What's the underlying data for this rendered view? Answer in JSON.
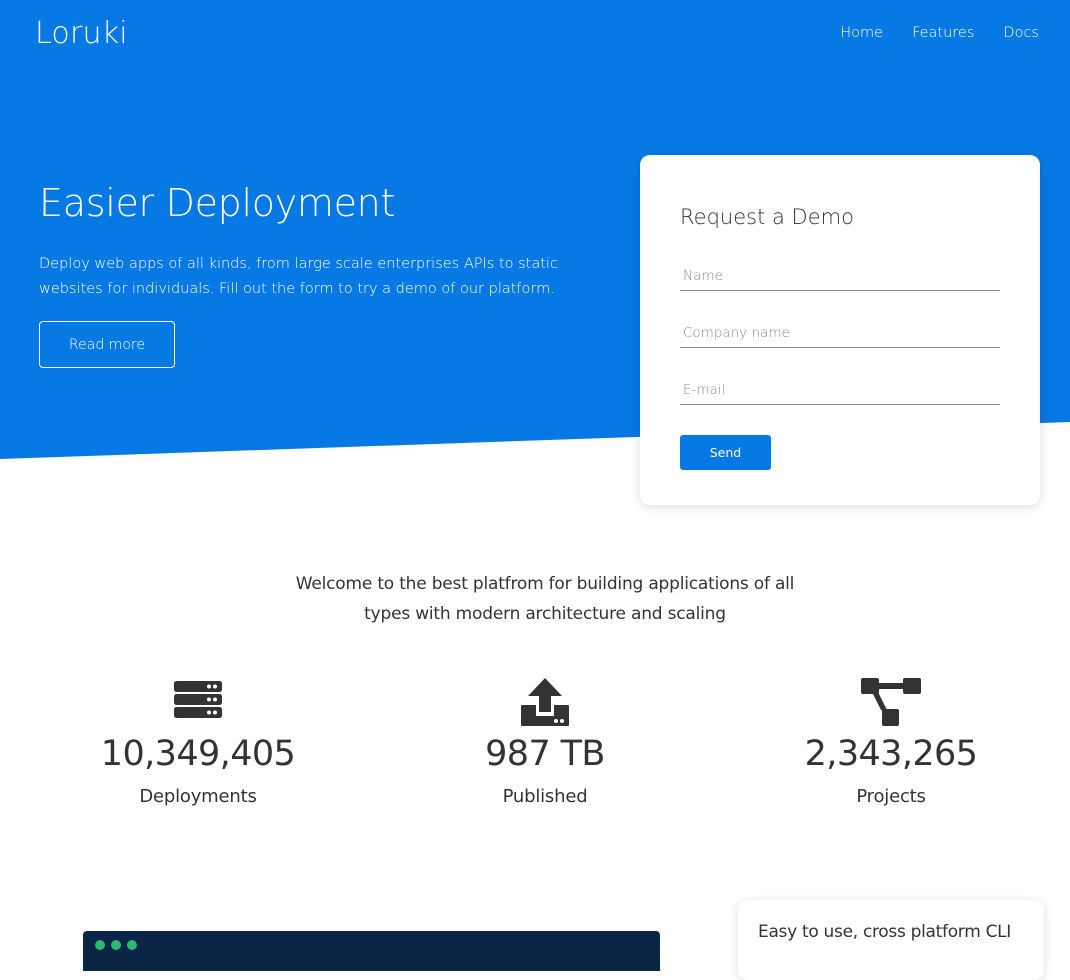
{
  "header": {
    "brand": "Loruki",
    "nav": [
      "Home",
      "Features",
      "Docs"
    ]
  },
  "hero": {
    "title": "Easier Deployment",
    "description": "Deploy web apps of all kinds, from large scale enterprises APIs to static websites for individuals. Fill out the form to try a demo of our platform.",
    "read_more_label": "Read more"
  },
  "demo_form": {
    "title": "Request a Demo",
    "name_placeholder": "Name",
    "company_placeholder": "Company name",
    "email_placeholder": "E-mail",
    "send_label": "Send"
  },
  "stats": {
    "welcome": "Welcome to the best platfrom for building applications of all types with modern architecture and scaling",
    "items": [
      {
        "icon": "server-icon",
        "value": "10,349,405",
        "label": "Deployments"
      },
      {
        "icon": "upload-icon",
        "value": "987 TB",
        "label": "Published"
      },
      {
        "icon": "project-diagram-icon",
        "value": "2,343,265",
        "label": "Projects"
      }
    ]
  },
  "cli": {
    "title": "Easy to use, cross platform CLI"
  },
  "colors": {
    "primary": "#0779e4",
    "text": "#333333",
    "terminal_bg": "#0b2545",
    "white": "#ffffff"
  }
}
